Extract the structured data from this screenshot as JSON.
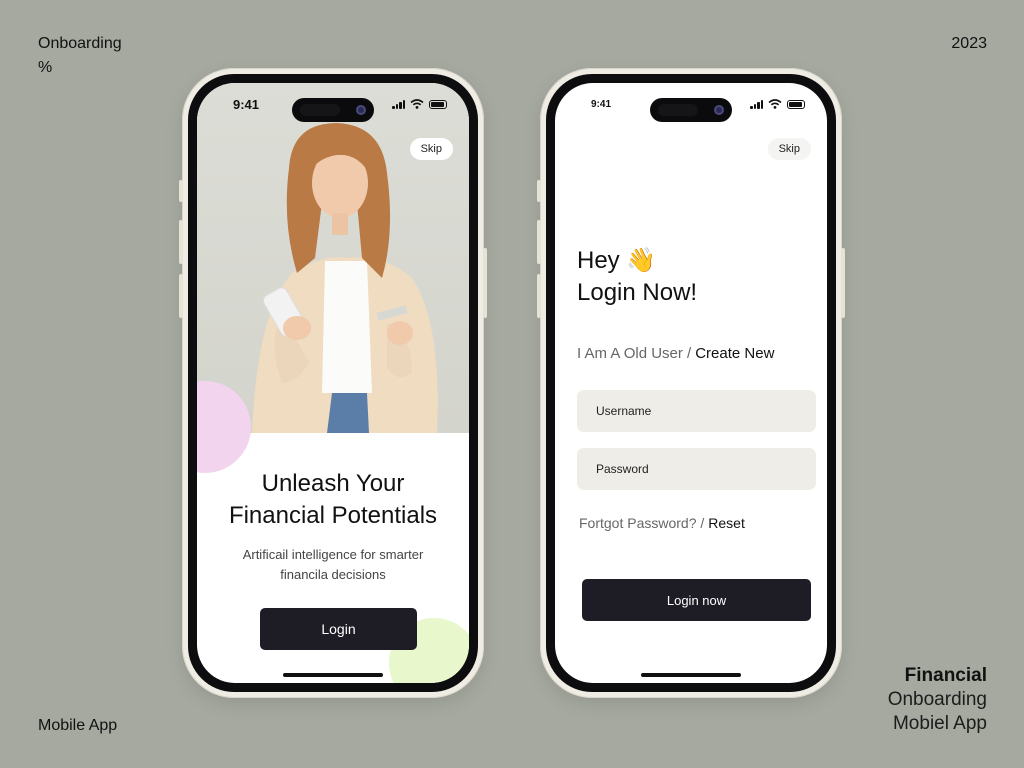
{
  "corners": {
    "top_left_line1": "Onboarding",
    "top_left_line2": "%",
    "top_right": "2023",
    "bottom_left": "Mobile App",
    "bottom_right_line1": "Financial",
    "bottom_right_line2": "Onboarding",
    "bottom_right_line3": "Mobiel App"
  },
  "phone1": {
    "time": "9:41",
    "skip_label": "Skip",
    "headline_line1": "Unleash Your",
    "headline_line2": "Financial Potentials",
    "subtitle_line1": "Artificail intelligence for smarter",
    "subtitle_line2": "financila decisions",
    "login_label": "Login"
  },
  "phone2": {
    "time": "9:41",
    "skip_label": "Skip",
    "greeting": "Hey 👋",
    "heading": "Login Now!",
    "old_user_text": "I Am A Old User /",
    "create_new_label": "Create New",
    "username_placeholder": "Username",
    "password_placeholder": "Password",
    "forgot_text": "Fortgot Password? /",
    "reset_label": "Reset",
    "login_label": "Login now"
  },
  "colors": {
    "background": "#a5a99f",
    "button_dark": "#1e1d26",
    "input_bg": "#eeede7",
    "accent_pink": "#f2d4ee",
    "accent_green": "#e8f7cc"
  }
}
